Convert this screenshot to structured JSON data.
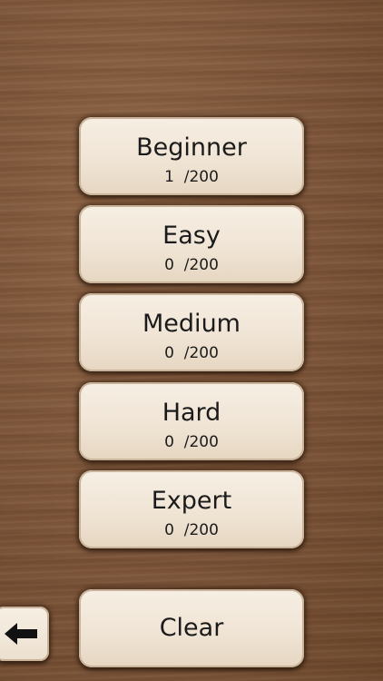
{
  "levels": [
    {
      "name": "Beginner",
      "progress": "1  /200"
    },
    {
      "name": "Easy",
      "progress": "0  /200"
    },
    {
      "name": "Medium",
      "progress": "0  /200"
    },
    {
      "name": "Hard",
      "progress": "0  /200"
    },
    {
      "name": "Expert",
      "progress": "0  /200"
    }
  ],
  "clear_label": "Clear",
  "back_icon": "back-arrow-icon",
  "colors": {
    "wood_background": "#7a5236",
    "button_face": "#f2e7d9",
    "text": "#1b1b1b"
  }
}
